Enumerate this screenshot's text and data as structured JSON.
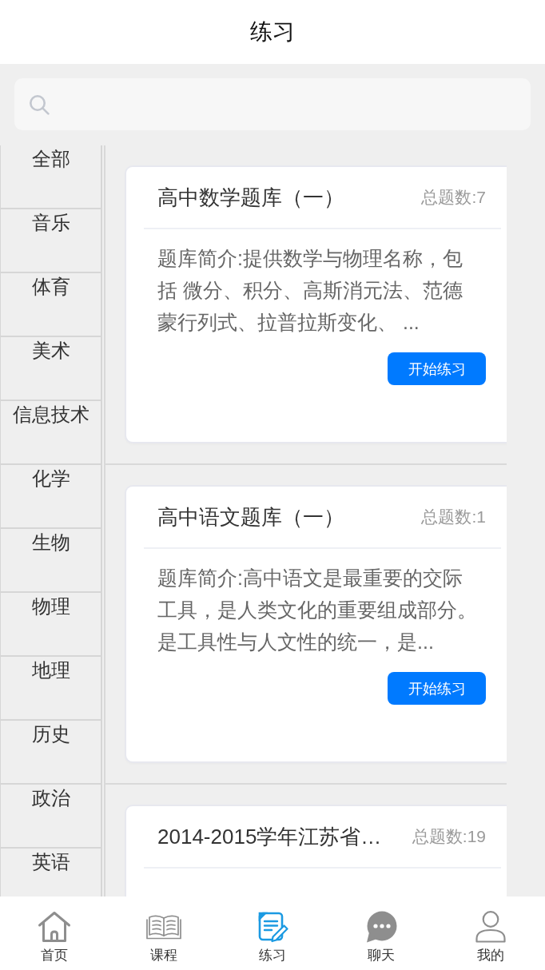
{
  "header": {
    "title": "练习"
  },
  "categories": [
    {
      "label": "全部"
    },
    {
      "label": "音乐"
    },
    {
      "label": "体育"
    },
    {
      "label": "美术"
    },
    {
      "label": "信息技术"
    },
    {
      "label": "化学"
    },
    {
      "label": "生物"
    },
    {
      "label": "物理"
    },
    {
      "label": "地理"
    },
    {
      "label": "历史"
    },
    {
      "label": "政治"
    },
    {
      "label": "英语"
    }
  ],
  "question_banks": [
    {
      "title": "高中数学题库（一）",
      "count": "总题数:7",
      "description": "题库简介:提供数学与物理名称，包括 微分、积分、高斯消元法、范德蒙行列式、拉普拉斯变化、 ...",
      "button": "开始练习"
    },
    {
      "title": "高中语文题库（一）",
      "count": "总题数:1",
      "description": "题库简介:高中语文是最重要的交际工具，是人类文化的重要组成部分。是工具性与人文性的统一，是...",
      "button": "开始练习"
    },
    {
      "title": "2014-2015学年江苏省…",
      "count": "总题数:19"
    }
  ],
  "tab_bar": {
    "items": [
      {
        "label": "首页",
        "selected": false
      },
      {
        "label": "课程",
        "selected": false
      },
      {
        "label": "练习",
        "selected": true
      },
      {
        "label": "聊天",
        "selected": false
      },
      {
        "label": "我的",
        "selected": false
      }
    ]
  }
}
